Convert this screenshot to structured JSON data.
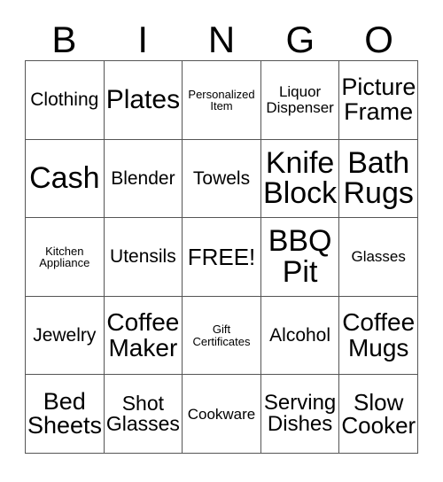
{
  "card": {
    "type": "bingo-card",
    "columns": 5,
    "rows": 5,
    "free_space": "FREE!",
    "border_color": "#555555",
    "text_color": "#000000",
    "background_color": "#ffffff"
  },
  "header": {
    "letters": [
      "B",
      "I",
      "N",
      "G",
      "O"
    ]
  },
  "grid": {
    "rows": [
      [
        {
          "text": "Clothing",
          "size": "m"
        },
        {
          "text": "Plates",
          "size": "xxl"
        },
        {
          "text": "Personalized\nItem",
          "size": "xs"
        },
        {
          "text": "Liquor\nDispenser",
          "size": "s"
        },
        {
          "text": "Picture\nFrame",
          "size": "xl"
        }
      ],
      [
        {
          "text": "Cash",
          "size": "xxl"
        },
        {
          "text": "Blender",
          "size": "m"
        },
        {
          "text": "Towels",
          "size": "m"
        },
        {
          "text": "Knife\nBlock",
          "size": "xxl"
        },
        {
          "text": "Bath\nRugs",
          "size": "xxl"
        }
      ],
      [
        {
          "text": "Kitchen\nAppliance",
          "size": "xs"
        },
        {
          "text": "Utensils",
          "size": "m"
        },
        {
          "text": "FREE!",
          "size": "l"
        },
        {
          "text": "BBQ\nPit",
          "size": "xxl"
        },
        {
          "text": "Glasses",
          "size": "s"
        }
      ],
      [
        {
          "text": "Jewelry",
          "size": "m"
        },
        {
          "text": "Coffee\nMaker",
          "size": "xxl"
        },
        {
          "text": "Gift\nCertificates",
          "size": "xs"
        },
        {
          "text": "Alcohol",
          "size": "m"
        },
        {
          "text": "Coffee\nMugs",
          "size": "xl"
        }
      ],
      [
        {
          "text": "Bed\nSheets",
          "size": "xl"
        },
        {
          "text": "Shot\nGlasses",
          "size": "l"
        },
        {
          "text": "Cookware",
          "size": "s"
        },
        {
          "text": "Serving\nDishes",
          "size": "l"
        },
        {
          "text": "Slow\nCooker",
          "size": "l"
        }
      ]
    ]
  }
}
